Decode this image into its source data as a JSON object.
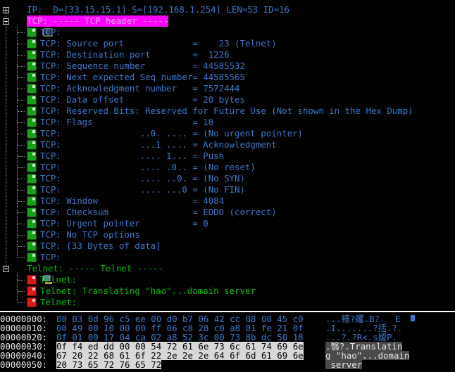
{
  "tree": {
    "ip_line": "IP:  D=[33.15.15.1] S=[192.168.1.254] LEN=53 ID=16",
    "tcp_header": "TCP: ----- TCP header -----",
    "tcp_lines": [
      "TCP:",
      "TCP: Source port             =    23 (Telnet)",
      "TCP: Destination port        =  1226",
      "TCP: Sequence number         = 44585532",
      "TCP: Next expected Seq number= 44585565",
      "TCP: Acknowledgment number   = 7572444",
      "TCP: Data offset             = 20 bytes",
      "TCP: Reserved Bits: Reserved for Future Use (Not shown in the Hex Dump)",
      "TCP: Flags                   = 18",
      "TCP:               ..0. .... = (No urgent pointer)",
      "TCP:               ...1 .... = Acknowledgment",
      "TCP:               .... 1... = Push",
      "TCP:               .... .0.. = (No reset)",
      "TCP:               .... ..0. = (No SYN)",
      "TCP:               .... ...0 = (No FIN)",
      "TCP: Window                  = 4084",
      "TCP: Checksum                = EDDD (correct)",
      "TCP: Urgent pointer          = 0",
      "TCP: No TCP options",
      "TCP: [33 Bytes of data]",
      "TCP:"
    ],
    "telnet_header": "Telnet: ----- Telnet -----",
    "telnet_lines": [
      "Telnet:",
      "Telnet: Translating \"hao\"...domain server",
      "Telnet:"
    ]
  },
  "hex_dump": {
    "rows": [
      {
        "offset": "00000000:",
        "hex_plain": "00 03 0d 96 c5 ee 00 d0 b7 06 42 cc 08 00 45 c0",
        "hex_hl": "",
        "ascii_plain": "...柵?蠼.B?.  E",
        "ascii_hl": ""
      },
      {
        "offset": "00000010:",
        "hex_plain": "00 49 00 10 00 00 ff 06 c8 28 c0 a8 01 fe 21 0f",
        "hex_hl": "",
        "ascii_plain": ".I.......?括.?.",
        "ascii_hl": ""
      },
      {
        "offset": "00000020:",
        "hex_plain": "0f 01 00 17 04 ca 02 a8 52 3c 00 73 8b dc 50 18",
        "hex_hl": "",
        "ascii_plain": "...?.?R<.s嬡P.",
        "ascii_hl": ""
      },
      {
        "offset": "00000030:",
        "hex_plain": "",
        "hex_hl": "0f f4 ed dd 00 00 54 72 61 6e 73 6c 61 74 69 6e",
        "ascii_plain": "",
        "ascii_hl": ".翳?.Translatin"
      },
      {
        "offset": "00000040:",
        "hex_plain": "",
        "hex_hl": "67 20 22 68 61 6f 22 2e 2e 2e 64 6f 6d 61 69 6e",
        "ascii_plain": "",
        "ascii_hl": "g \"hao\"...domain"
      },
      {
        "offset": "00000050:",
        "hex_plain": "",
        "hex_hl": "20 73 65 72 76 65 72",
        "ascii_plain": "",
        "ascii_hl": " server"
      }
    ]
  },
  "colors": {
    "background": "#000000",
    "tcp_text": "#3c78c8",
    "telnet_text": "#00c000",
    "selection": "#ff00ff",
    "hex_highlight": "#d8d8d8"
  }
}
